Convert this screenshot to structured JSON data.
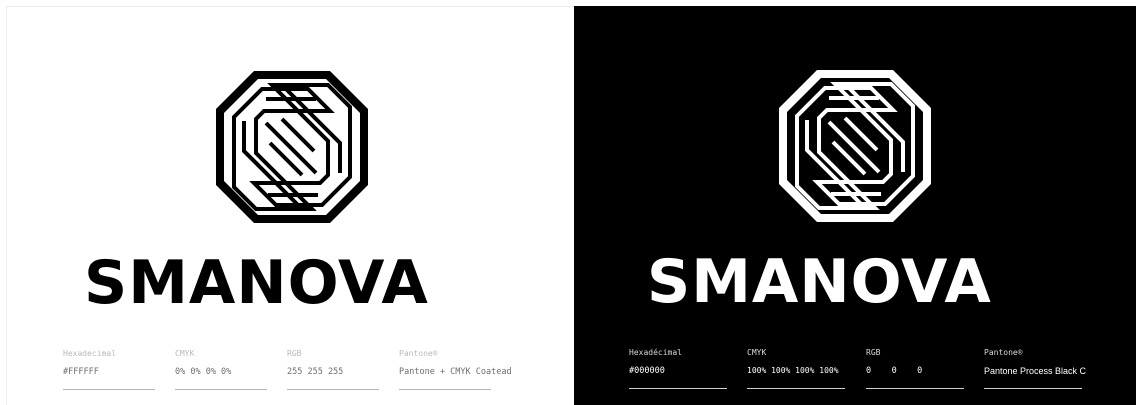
{
  "light": {
    "brand": "SMANOVA",
    "mark_icon": "octagon-s-monogram-icon",
    "colors": {
      "background": "#ffffff",
      "foreground": "#000000"
    },
    "swatches": [
      {
        "label": "Hexadecimal",
        "value": "#FFFFFF"
      },
      {
        "label": "CMYK",
        "value": "0% 0% 0% 0%"
      },
      {
        "label": "RGB",
        "value": "255 255 255"
      },
      {
        "label": "Pantone®",
        "value": "Pantone + CMYK Coatead"
      }
    ]
  },
  "dark": {
    "brand": "SMANOVA",
    "mark_icon": "octagon-s-monogram-icon",
    "colors": {
      "background": "#000000",
      "foreground": "#ffffff"
    },
    "swatches": [
      {
        "label": "Hexadécimal",
        "value": "#000000"
      },
      {
        "label": "CMYK",
        "value": "100% 100% 100% 100%"
      },
      {
        "label": "RGB",
        "value": "0    0    0"
      },
      {
        "label": "Pantone®",
        "value": "Pantone Process Black C"
      }
    ]
  }
}
